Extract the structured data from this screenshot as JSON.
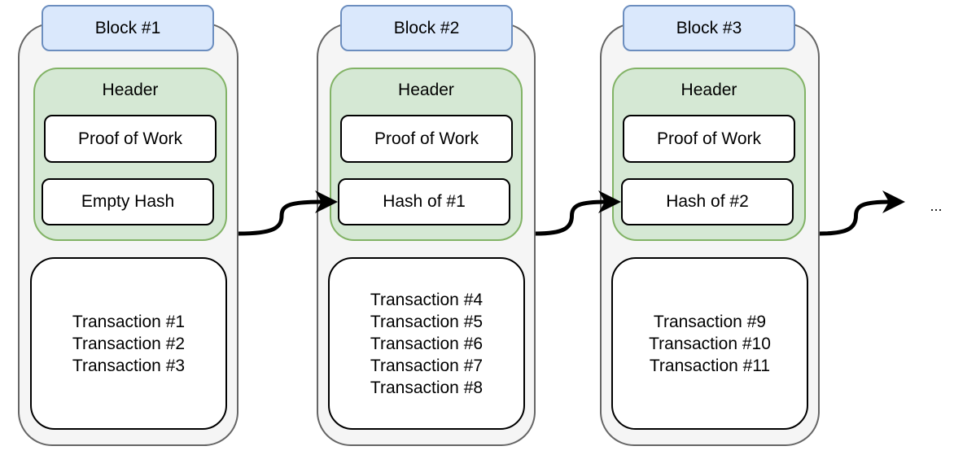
{
  "blocks": [
    {
      "title": "Block #1",
      "header": "Header",
      "pow": "Proof of Work",
      "hash": "Empty Hash",
      "transactions": [
        "Transaction #1",
        "Transaction #2",
        "Transaction #3"
      ]
    },
    {
      "title": "Block #2",
      "header": "Header",
      "pow": "Proof of Work",
      "hash": "Hash of #1",
      "transactions": [
        "Transaction #4",
        "Transaction #5",
        "Transaction #6",
        "Transaction #7",
        "Transaction #8"
      ]
    },
    {
      "title": "Block #3",
      "header": "Header",
      "pow": "Proof of Work",
      "hash": "Hash of #2",
      "transactions": [
        "Transaction #9",
        "Transaction #10",
        "Transaction #11"
      ]
    }
  ],
  "continuation": "...",
  "colors": {
    "tab_fill": "#dae8fc",
    "tab_stroke": "#6c8ebf",
    "header_fill": "#d5e8d4",
    "header_stroke": "#82b366",
    "block_fill": "#f5f5f5",
    "block_stroke": "#666666"
  }
}
